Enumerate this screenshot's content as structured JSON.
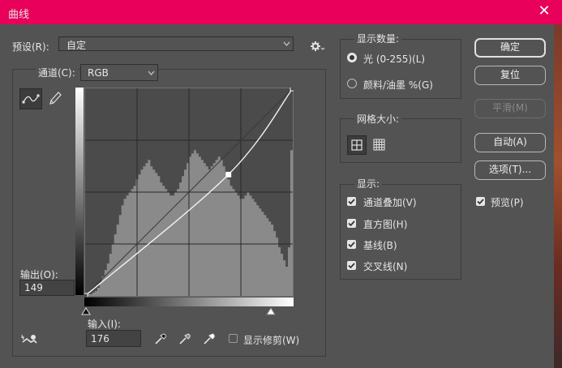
{
  "window": {
    "title": "曲线",
    "close_glyph": "✕"
  },
  "preset": {
    "label": "预设(R):",
    "value": "自定"
  },
  "channel": {
    "label": "通道(C):",
    "value": "RGB"
  },
  "output": {
    "label": "输出(O):",
    "value": "149"
  },
  "input": {
    "label": "输入(I):",
    "value": "176"
  },
  "show_clipping": {
    "label": "显示修剪(W)",
    "checked": false
  },
  "show_amount": {
    "legend": "显示数量:",
    "light": "光 (0-255)(L)",
    "pigment": "颜料/油墨 %(G)",
    "selected": "light"
  },
  "grid_size": {
    "legend": "网格大小:"
  },
  "show": {
    "legend": "显示:",
    "items": [
      {
        "label": "通道叠加(V)",
        "checked": true
      },
      {
        "label": "直方图(H)",
        "checked": true
      },
      {
        "label": "基线(B)",
        "checked": true
      },
      {
        "label": "交叉线(N)",
        "checked": true
      }
    ]
  },
  "buttons": {
    "ok": "确定",
    "reset": "复位",
    "smooth": "平滑(M)",
    "auto": "自动(A)",
    "options": "选项(T)..."
  },
  "preview": {
    "label": "预览(P)",
    "checked": true
  },
  "icons": {
    "gear": "gear-icon",
    "curve_tool": "curve-tool-icon",
    "pencil": "pencil-icon",
    "eyedroppers": [
      "black-eyedropper-icon",
      "gray-eyedropper-icon",
      "white-eyedropper-icon"
    ],
    "on_image": "on-image-adjust-icon"
  },
  "curve": {
    "points": [
      [
        0,
        0
      ],
      [
        176,
        149
      ],
      [
        255,
        255
      ]
    ],
    "output_value": 149,
    "input_value": 176,
    "histogram": [
      1,
      1,
      1,
      2,
      3,
      5,
      8,
      12,
      16,
      20,
      26,
      32,
      38,
      44,
      50,
      56,
      60,
      62,
      64,
      66,
      68,
      72,
      75,
      78,
      80,
      82,
      84,
      80,
      78,
      76,
      74,
      70,
      68,
      66,
      64,
      62,
      62,
      64,
      66,
      70,
      74,
      78,
      82,
      86,
      88,
      90,
      88,
      86,
      84,
      82,
      80,
      78,
      80,
      82,
      84,
      86,
      84,
      80,
      76,
      72,
      68,
      66,
      64,
      62,
      60,
      60,
      62,
      64,
      62,
      60,
      58,
      56,
      54,
      52,
      50,
      48,
      46,
      44,
      40,
      36,
      30,
      26,
      22,
      18,
      30,
      90
    ]
  }
}
